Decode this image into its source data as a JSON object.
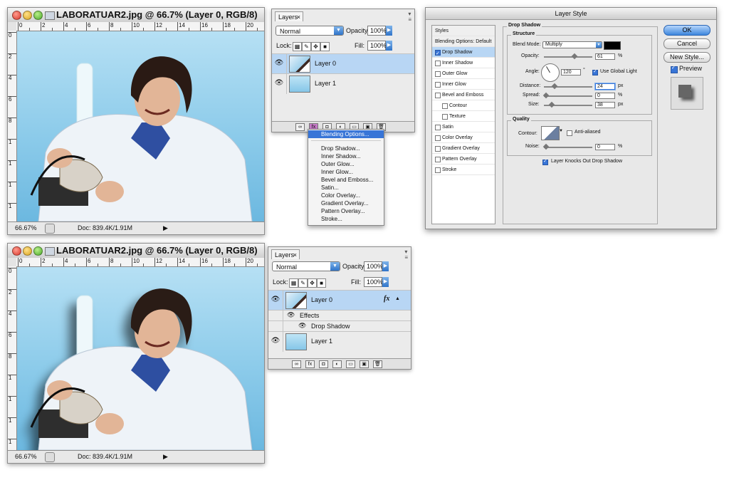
{
  "top": {
    "doc": {
      "title": "LABORATUAR2.jpg @ 66.7% (Layer 0, RGB/8)",
      "zoom": "66.67%",
      "docsize": "Doc: 839.4K/1.91M",
      "ruler_h": [
        "0",
        "2",
        "4",
        "6",
        "8",
        "10",
        "12",
        "14",
        "16",
        "18",
        "20"
      ],
      "ruler_v": [
        "0",
        "2",
        "4",
        "6",
        "8",
        "1",
        "1",
        "1",
        "1"
      ]
    },
    "layers": {
      "tab": "Layers",
      "blend": "Normal",
      "opacity_label": "Opacity:",
      "opacity": "100%",
      "lock_label": "Lock:",
      "fill_label": "Fill:",
      "fill": "100%",
      "items": [
        {
          "name": "Layer 0"
        },
        {
          "name": "Layer 1"
        }
      ]
    },
    "menu": {
      "items": [
        "Blending Options...",
        "Drop Shadow...",
        "Inner Shadow...",
        "Outer Glow...",
        "Inner Glow...",
        "Bevel and Emboss...",
        "Satin...",
        "Color Overlay...",
        "Gradient Overlay...",
        "Pattern Overlay...",
        "Stroke..."
      ]
    }
  },
  "dialog": {
    "title": "Layer Style",
    "styles_header": "Styles",
    "styles": [
      {
        "label": "Blending Options: Default",
        "checkbox": false
      },
      {
        "label": "Drop Shadow",
        "checked": true
      },
      {
        "label": "Inner Shadow",
        "checked": false
      },
      {
        "label": "Outer Glow",
        "checked": false
      },
      {
        "label": "Inner Glow",
        "checked": false
      },
      {
        "label": "Bevel and Emboss",
        "checked": false
      },
      {
        "label": "Contour",
        "checked": false
      },
      {
        "label": "Texture",
        "checked": false
      },
      {
        "label": "Satin",
        "checked": false
      },
      {
        "label": "Color Overlay",
        "checked": false
      },
      {
        "label": "Gradient Overlay",
        "checked": false
      },
      {
        "label": "Pattern Overlay",
        "checked": false
      },
      {
        "label": "Stroke",
        "checked": false
      }
    ],
    "section_title": "Drop Shadow",
    "structure_title": "Structure",
    "blend_mode_label": "Blend Mode:",
    "blend_mode": "Multiply",
    "opacity_label": "Opacity:",
    "opacity": "61",
    "opacity_unit": "%",
    "angle_label": "Angle:",
    "angle": "120",
    "angle_unit": "°",
    "global_light": "Use Global Light",
    "distance_label": "Distance:",
    "distance": "24",
    "distance_unit": "px",
    "spread_label": "Spread:",
    "spread": "0",
    "spread_unit": "%",
    "size_label": "Size:",
    "size": "38",
    "size_unit": "px",
    "quality_title": "Quality",
    "contour_label": "Contour:",
    "anti_aliased": "Anti-aliased",
    "noise_label": "Noise:",
    "noise": "0",
    "noise_unit": "%",
    "knockout": "Layer Knocks Out Drop Shadow",
    "buttons": {
      "ok": "OK",
      "cancel": "Cancel",
      "new_style": "New Style..."
    },
    "preview_label": "Preview",
    "shadow_color": "#000000"
  },
  "bottom": {
    "doc": {
      "title": "LABORATUAR2.jpg @ 66.7% (Layer 0, RGB/8)",
      "zoom": "66.67%",
      "docsize": "Doc: 839.4K/1.91M",
      "ruler_h": [
        "0",
        "2",
        "4",
        "6",
        "8",
        "10",
        "12",
        "14",
        "16",
        "18",
        "20"
      ],
      "ruler_v": [
        "0",
        "2",
        "4",
        "6",
        "8",
        "1",
        "1",
        "1",
        "1"
      ]
    },
    "layers": {
      "tab": "Layers",
      "blend": "Normal",
      "opacity_label": "Opacity:",
      "opacity": "100%",
      "lock_label": "Lock:",
      "fill_label": "Fill:",
      "fill": "100%",
      "layer0": "Layer 0",
      "fx": "fx",
      "effects": "Effects",
      "drop_shadow": "Drop Shadow",
      "layer1": "Layer 1"
    }
  },
  "colors": {
    "selection": "#b8d6f4",
    "accent": "#3875d7",
    "sky_top": "#b6e0f4",
    "sky_bottom": "#6cb8e0"
  }
}
